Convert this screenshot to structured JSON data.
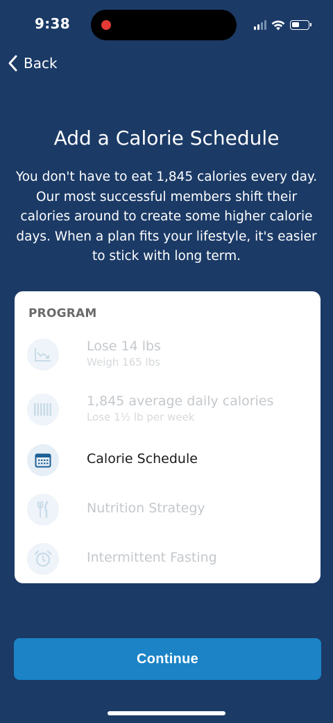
{
  "status": {
    "time": "9:38"
  },
  "nav": {
    "back_label": "Back"
  },
  "header": {
    "title": "Add a Calorie Schedule",
    "description": "You don't have to eat 1,845 calories every day. Our most successful members shift their calories around to create some higher calorie days. When a plan fits your lifestyle, it's easier to stick with long term."
  },
  "program": {
    "title": "PROGRAM",
    "items": [
      {
        "icon": "weight-trend-icon",
        "label": "Lose 14 lbs",
        "sublabel": "Weigh 165 lbs",
        "state": "done"
      },
      {
        "icon": "calorie-bars-icon",
        "label": "1,845 average daily calories",
        "sublabel": "Lose 1½ lb per week",
        "state": "done"
      },
      {
        "icon": "calendar-icon",
        "label": "Calorie Schedule",
        "sublabel": "",
        "state": "current"
      },
      {
        "icon": "fork-knife-icon",
        "label": "Nutrition Strategy",
        "sublabel": "",
        "state": "upcoming"
      },
      {
        "icon": "alarm-clock-icon",
        "label": "Intermittent Fasting",
        "sublabel": "",
        "state": "upcoming"
      }
    ]
  },
  "actions": {
    "continue_label": "Continue"
  },
  "colors": {
    "background": "#1b3a66",
    "accent": "#1b83c6",
    "card": "#ffffff",
    "recording_dot": "#e53935"
  }
}
